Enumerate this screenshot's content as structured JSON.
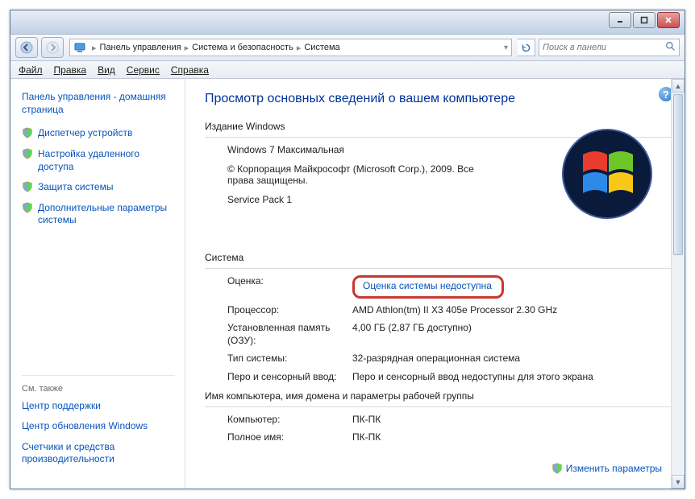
{
  "window": {
    "breadcrumb": {
      "root_icon": "computer-icon",
      "items": [
        "Панель управления",
        "Система и безопасность",
        "Система"
      ]
    },
    "search_placeholder": "Поиск в панели"
  },
  "menu": {
    "file": "Файл",
    "edit": "Правка",
    "view": "Вид",
    "service": "Сервис",
    "help": "Справка"
  },
  "sidebar": {
    "home": "Панель управления - домашняя страница",
    "links": [
      {
        "label": "Диспетчер устройств",
        "shield": true
      },
      {
        "label": "Настройка удаленного доступа",
        "shield": true
      },
      {
        "label": "Защита системы",
        "shield": true
      },
      {
        "label": "Дополнительные параметры системы",
        "shield": true
      }
    ],
    "see_also_title": "См. также",
    "see_also": [
      {
        "label": "Центр поддержки"
      },
      {
        "label": "Центр обновления Windows"
      },
      {
        "label": "Счетчики и средства производительности"
      }
    ]
  },
  "content": {
    "heading": "Просмотр основных сведений о вашем компьютере",
    "edition_title": "Издание Windows",
    "edition_name": "Windows 7 Максимальная",
    "copyright": "© Корпорация Майкрософт (Microsoft Corp.), 2009. Все права защищены.",
    "service_pack": "Service Pack 1",
    "system_title": "Система",
    "rows": {
      "rating_lbl": "Оценка:",
      "rating_val": "Оценка системы недоступна",
      "cpu_lbl": "Процессор:",
      "cpu_val": "AMD Athlon(tm) II X3 405e Processor   2.30 GHz",
      "mem_lbl": "Установленная память (ОЗУ):",
      "mem_val": "4,00 ГБ (2,87 ГБ доступно)",
      "type_lbl": "Тип системы:",
      "type_val": "32-разрядная операционная система",
      "pen_lbl": "Перо и сенсорный ввод:",
      "pen_val": "Перо и сенсорный ввод недоступны для этого экрана"
    },
    "workgroup_title": "Имя компьютера, имя домена и параметры рабочей группы",
    "wg_rows": {
      "computer_lbl": "Компьютер:",
      "computer_val": "ПК-ПК",
      "fullname_lbl": "Полное имя:",
      "fullname_val": "ПК-ПК"
    },
    "change_link": "Изменить параметры"
  }
}
